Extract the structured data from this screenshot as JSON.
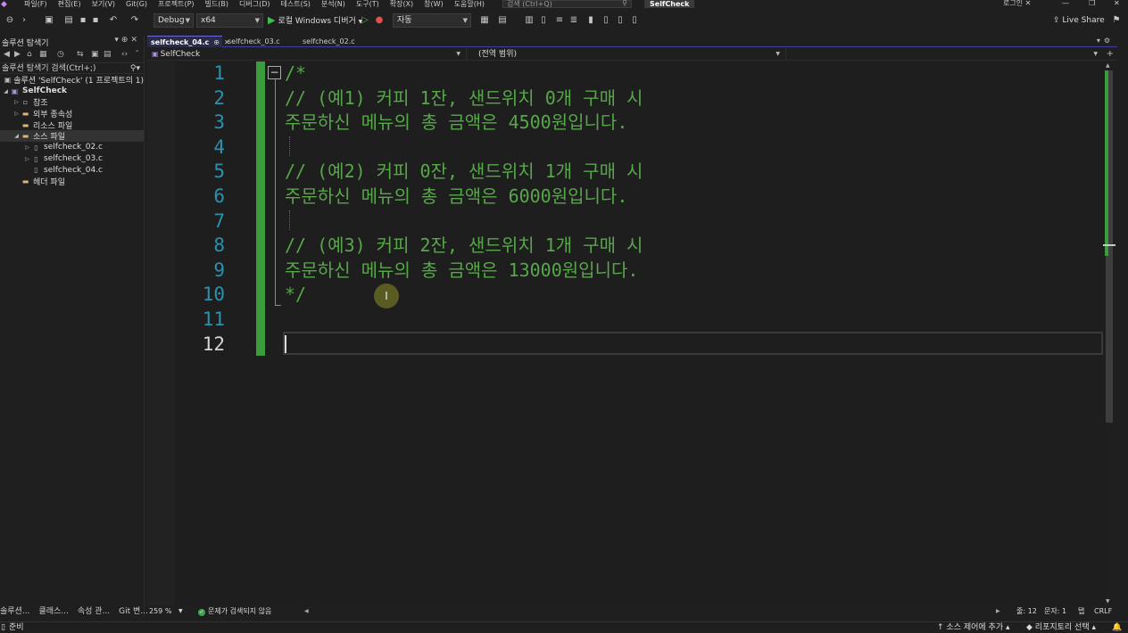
{
  "menubar": {
    "items": [
      "파일(F)",
      "편집(E)",
      "보기(V)",
      "Git(G)",
      "프로젝트(P)",
      "빌드(B)",
      "디버그(D)",
      "테스트(S)",
      "분석(N)",
      "도구(T)",
      "확장(X)",
      "창(W)",
      "도움말(H)"
    ],
    "search_placeholder": "검색 (Ctrl+Q)",
    "solution_name": "SelfCheck",
    "login": "로그인"
  },
  "toolbar": {
    "configuration": "Debug",
    "platform": "x64",
    "debugger": "로컬 Windows 디버거",
    "auto": "자동",
    "live_share": "Live Share"
  },
  "solution_explorer": {
    "title": "솔루션 탐색기",
    "search": "솔루션 탐색기 검색(Ctrl+;)",
    "tree": [
      {
        "label": "솔루션 'SelfCheck' (1 프로젝트의 1)",
        "icon": "solution-icon",
        "depth": 0,
        "expander": ""
      },
      {
        "label": "SelfCheck",
        "icon": "project-icon",
        "depth": 0,
        "expander": "expanded",
        "bold": true
      },
      {
        "label": "참조",
        "icon": "references-icon",
        "depth": 1,
        "expander": "collapsed"
      },
      {
        "label": "외부 종속성",
        "icon": "folder-icon",
        "depth": 1,
        "expander": "collapsed"
      },
      {
        "label": "리소스 파일",
        "icon": "folder-icon",
        "depth": 1,
        "expander": ""
      },
      {
        "label": "소스 파일",
        "icon": "folder-icon",
        "depth": 1,
        "expander": "expanded",
        "selected": true
      },
      {
        "label": "selfcheck_02.c",
        "icon": "c-file-icon",
        "depth": 2,
        "expander": "collapsed"
      },
      {
        "label": "selfcheck_03.c",
        "icon": "c-file-icon",
        "depth": 2,
        "expander": "collapsed"
      },
      {
        "label": "selfcheck_04.c",
        "icon": "c-file-icon",
        "depth": 2,
        "expander": ""
      },
      {
        "label": "헤더 파일",
        "icon": "folder-icon",
        "depth": 1,
        "expander": ""
      }
    ],
    "bottom_tabs": [
      "솔루션...",
      "클래스...",
      "속성 관...",
      "Git 변..."
    ]
  },
  "editor_tabs": [
    {
      "label": "selfcheck_04.c",
      "active": true
    },
    {
      "label": "selfcheck_03.c",
      "active": false
    },
    {
      "label": "selfcheck_02.c",
      "active": false
    }
  ],
  "navbar": {
    "project": "SelfCheck",
    "scope": "(전역 범위)"
  },
  "editor": {
    "lines": [
      {
        "number": "1",
        "text": "/*"
      },
      {
        "number": "2",
        "text": "// (예1) 커피 1잔, 샌드위치 0개 구매 시"
      },
      {
        "number": "3",
        "text": "주문하신 메뉴의 총 금액은 4500원입니다."
      },
      {
        "number": "4",
        "text": ""
      },
      {
        "number": "5",
        "text": "// (예2) 커피 0잔, 샌드위치 1개 구매 시"
      },
      {
        "number": "6",
        "text": "주문하신 메뉴의 총 금액은 6000원입니다."
      },
      {
        "number": "7",
        "text": ""
      },
      {
        "number": "8",
        "text": "// (예3) 커피 2잔, 샌드위치 1개 구매 시"
      },
      {
        "number": "9",
        "text": "주문하신 메뉴의 총 금액은 13000원입니다."
      },
      {
        "number": "10",
        "text": "*/"
      },
      {
        "number": "11",
        "text": ""
      },
      {
        "number": "12",
        "text": ""
      }
    ],
    "current_line": 12,
    "comment_color": "#57a64a",
    "line_number_color": "#2b91af",
    "change_bar_color": "#3b9c3b"
  },
  "editor_status": {
    "zoom": "259 %",
    "issues": "문제가 검색되지 않음",
    "line": "줄: 12",
    "col": "문자: 1",
    "tab": "탭",
    "eol": "CRLF"
  },
  "statusbar": {
    "ready": "준비",
    "source_control": "소스 제어에 추가",
    "repository": "리포지토리 선택"
  }
}
